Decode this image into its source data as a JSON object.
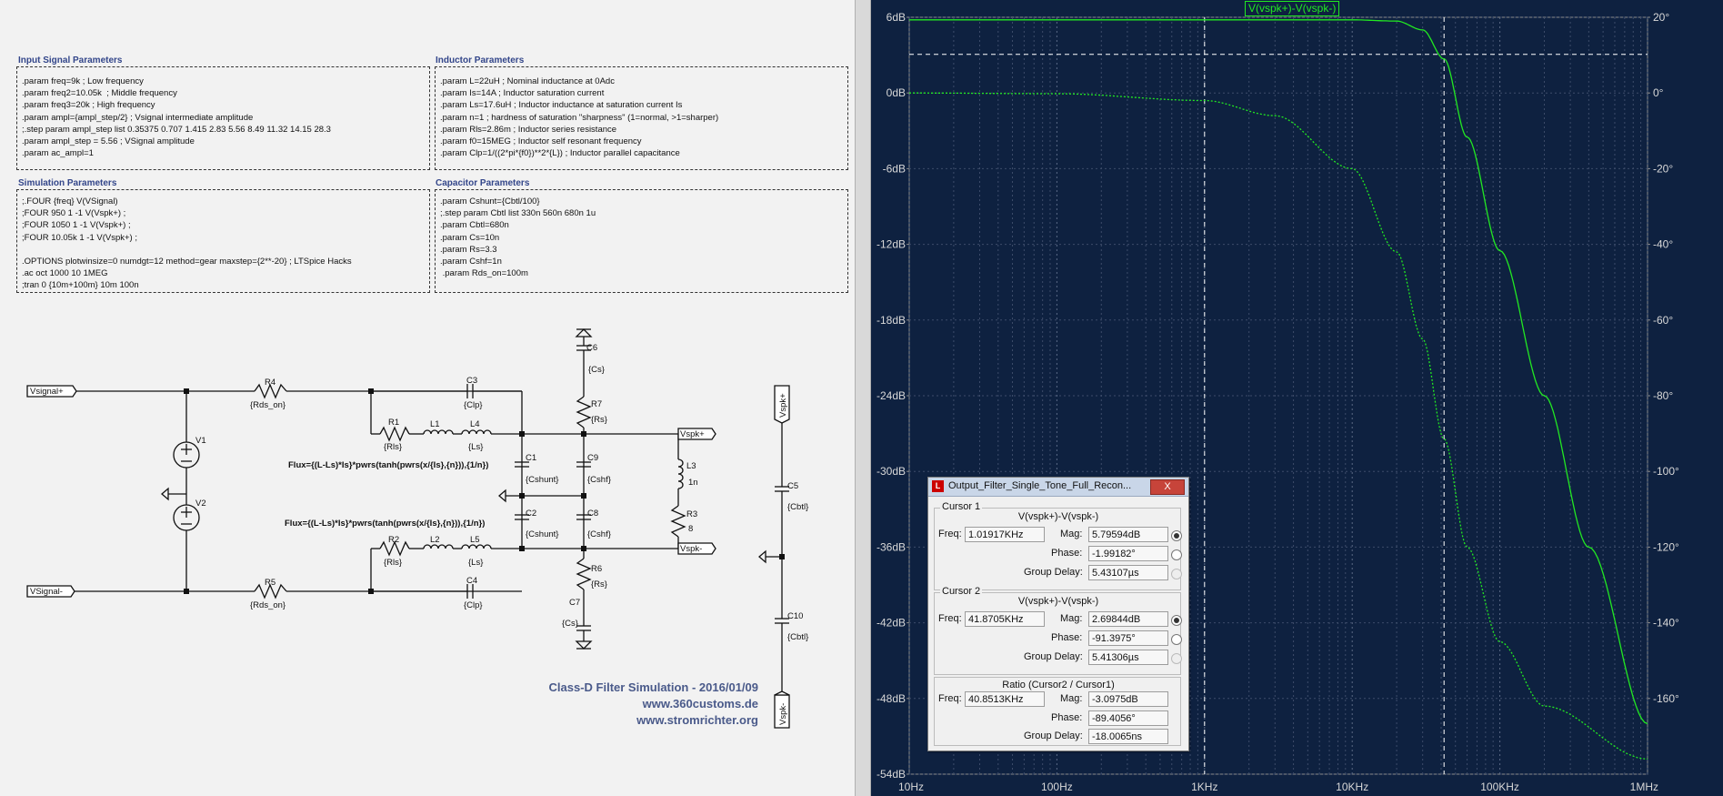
{
  "schematic": {
    "boxes": {
      "input": {
        "title": "Input Signal Parameters",
        "lines": [
          ".param freq=9k ; Low frequency",
          ".param freq2=10.05k  ; Middle frequency",
          ".param freq3=20k ; High frequency",
          ".param ampl={ampl_step/2} ; Vsignal intermediate amplitude",
          ";.step param ampl_step list 0.35375 0.707 1.415 2.83 5.56 8.49 11.32 14.15 28.3",
          ".param ampl_step = 5.56 ; VSignal amplitude",
          ".param ac_ampl=1"
        ]
      },
      "inductor": {
        "title": "Inductor Parameters",
        "lines": [
          ".param L=22uH ; Nominal inductance at 0Adc",
          ".param Is=14A ; Inductor saturation current",
          ".param Ls=17.6uH ; Inductor inductance at saturation current Is",
          ".param n=1 ; hardness of saturation \"sharpness\" (1=normal, >1=sharper)",
          ".param Rls=2.86m ; Inductor series resistance",
          ".param f0=15MEG ; Inductor self resonant frequency",
          ".param Clp=1/((2*pi*{f0})**2*{L}) ; Inductor parallel capacitance"
        ]
      },
      "simulation": {
        "title": "Simulation Parameters",
        "lines": [
          ";.FOUR {freq} V(VSignal)",
          ";FOUR 950 1 -1 V(Vspk+) ;",
          ";FOUR 1050 1 -1 V(Vspk+) ;",
          ";FOUR 10.05k 1 -1 V(Vspk+) ;",
          "",
          ".OPTIONS plotwinsize=0 numdgt=12 method=gear maxstep={2**-20} ; LTSpice Hacks",
          ".ac oct 1000 10 1MEG",
          ";tran 0 {10m+100m} 10m 100n"
        ]
      },
      "capacitor": {
        "title": "Capacitor Parameters",
        "lines": [
          ".param Cshunt={Cbtl/100}",
          ";.step param Cbtl list 330n 560n 680n 1u",
          ".param Cbtl=680n",
          ".param Cs=10n",
          ".param Rs=3.3",
          ".param Cshf=1n",
          " .param Rds_on=100m"
        ]
      }
    },
    "labels": {
      "vsig_p": "Vsignal+",
      "vsig_n": "VSignal-",
      "vspk_p": "Vspk+",
      "vspk_n": "Vspk-",
      "vspk_p_v": "Vspk+",
      "vspk_n_v": "Vspk-",
      "R4": "R4",
      "R4v": "{Rds_on}",
      "R5": "R5",
      "R5v": "{Rds_on}",
      "C3": "C3",
      "C3v": "{Clp}",
      "C4": "C4",
      "C4v": "{Clp}",
      "R1": "R1",
      "R1v": "{Rls}",
      "R2": "R2",
      "R2v": "{Rls}",
      "L1": "L1",
      "L2": "L2",
      "L4": "L4",
      "L4v": "{Ls}",
      "L5": "L5",
      "L5v": "{Ls}",
      "C1": "C1",
      "C1v": "{Cshunt}",
      "C2": "C2",
      "C2v": "{Cshunt}",
      "C9": "C9",
      "C9v": "{Cshf}",
      "C8": "C8",
      "C8v": "{Cshf}",
      "C6": "C6",
      "C6v": "{Cs}",
      "C7": "C7",
      "C7v": "{Cs}",
      "R7": "R7",
      "R7v": "{Rs}",
      "R6": "R6",
      "R6v": "{Rs}",
      "L3": "L3",
      "L3v": "1n",
      "R3": "R3",
      "R3v": "8",
      "C5": "C5",
      "C5v": "{Cbtl}",
      "C10": "C10",
      "C10v": "{Cbtl}",
      "V1": "V1",
      "V2": "V2",
      "flux1": "Flux={(L-Ls)*Is}*pwrs(tanh(pwrs(x/{Is},{n})),{1/n})",
      "flux2": "Flux={(L-Ls)*Is}*pwrs(tanh(pwrs(x/{Is},{n})),{1/n})"
    },
    "credits": [
      "Class-D Filter Simulation - 2016/01/09",
      "www.360customs.de",
      "www.stromrichter.org"
    ]
  },
  "plot": {
    "trace_label": "V(vspk+)-V(vspk-)",
    "trace_color": "#22e822",
    "background": "#0e2140",
    "left_ticks": [
      "6dB",
      "0dB",
      "-6dB",
      "-12dB",
      "-18dB",
      "-24dB",
      "-30dB",
      "-36dB",
      "-42dB",
      "-48dB",
      "-54dB"
    ],
    "right_ticks": [
      "20°",
      "0°",
      "-20°",
      "-40°",
      "-60°",
      "-80°",
      "-100°",
      "-120°",
      "-140°",
      "-160°"
    ],
    "x_ticks": [
      "10Hz",
      "100Hz",
      "1KHz",
      "10KHz",
      "100KHz",
      "1MHz"
    ]
  },
  "chart_data": {
    "type": "line",
    "x_scale": "log",
    "xlim": [
      10,
      1000000
    ],
    "ylim_left_db": [
      -54,
      6
    ],
    "ylim_right_deg": [
      -180,
      20
    ],
    "series": [
      {
        "name": "V(vspk+)-V(vspk-)",
        "axis": "magnitude_dB",
        "style": "solid",
        "x": [
          10,
          1000,
          10000,
          20000,
          30000,
          41870,
          60000,
          100000,
          200000,
          400000,
          1000000
        ],
        "y": [
          5.8,
          5.8,
          5.8,
          5.7,
          5.0,
          2.7,
          -3.5,
          -12.5,
          -24,
          -36,
          -50
        ]
      },
      {
        "name": "V(vspk+)-V(vspk-)",
        "axis": "phase_deg",
        "style": "dotted",
        "x": [
          10,
          100,
          1000,
          3000,
          10000,
          20000,
          30000,
          41870,
          60000,
          100000,
          200000,
          1000000
        ],
        "y": [
          0,
          -0.2,
          -2,
          -6,
          -20,
          -42,
          -65,
          -91.4,
          -120,
          -145,
          -162,
          -176
        ]
      }
    ],
    "cursor_dashed_x": [
      1000,
      41870
    ]
  },
  "dialog": {
    "title": "Output_Filter_Single_Tone_Full_Recon...",
    "close_label": "X",
    "cursor1": {
      "group": "Cursor 1",
      "trace": "V(vspk+)-V(vspk-)",
      "freq_label": "Freq:",
      "freq": "1.01917KHz",
      "mag_label": "Mag:",
      "mag": "5.79594dB",
      "phase_label": "Phase:",
      "phase": "-1.99182°",
      "gd_label": "Group Delay:",
      "gd": "5.43107µs"
    },
    "cursor2": {
      "group": "Cursor 2",
      "trace": "V(vspk+)-V(vspk-)",
      "freq_label": "Freq:",
      "freq": "41.8705KHz",
      "mag_label": "Mag:",
      "mag": "2.69844dB",
      "phase_label": "Phase:",
      "phase": "-91.3975°",
      "gd_label": "Group Delay:",
      "gd": "5.41306µs"
    },
    "ratio": {
      "group": "Ratio (Cursor2 / Cursor1)",
      "freq_label": "Freq:",
      "freq": "40.8513KHz",
      "mag_label": "Mag:",
      "mag": "-3.0975dB",
      "phase_label": "Phase:",
      "phase": "-89.4056°",
      "gd_label": "Group Delay:",
      "gd": "-18.0065ns"
    }
  }
}
